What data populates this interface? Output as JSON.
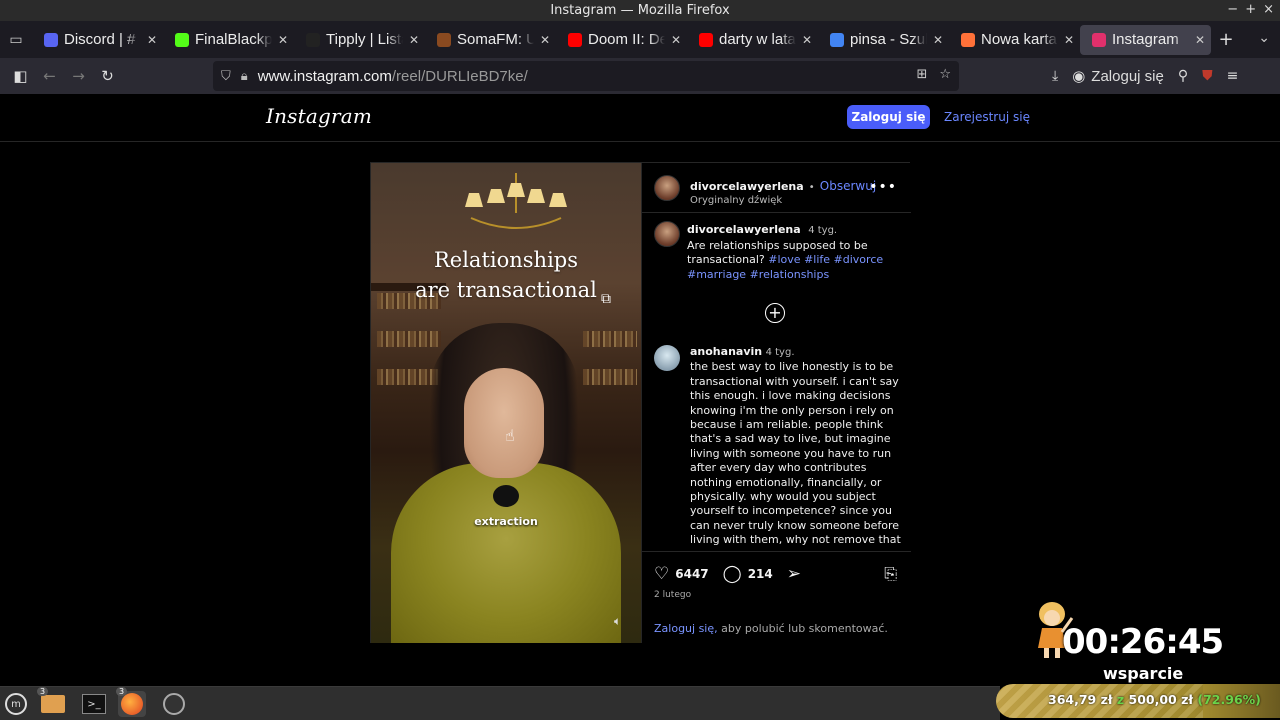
{
  "window": {
    "title": "Instagram — Mozilla Firefox",
    "controls": [
      "−",
      "+",
      "×"
    ]
  },
  "tabs": [
    {
      "label": "Discord | #",
      "icon": "discord-icon",
      "color": "#5865f2",
      "active": false
    },
    {
      "label": "FinalBlackpill",
      "icon": "kick-icon",
      "color": "#53fc18",
      "active": false
    },
    {
      "label": "Tipply | Lista",
      "icon": "tipply-icon",
      "color": "#222222",
      "active": false
    },
    {
      "label": "SomaFM: Uni",
      "icon": "somafm-icon",
      "color": "#8a4a20",
      "active": false
    },
    {
      "label": "Doom II: Deli",
      "icon": "youtube-icon",
      "color": "#ff0000",
      "active": false
    },
    {
      "label": "darty w latach",
      "icon": "youtube-icon",
      "color": "#ff0000",
      "active": false
    },
    {
      "label": "pinsa - Szuka",
      "icon": "google-icon",
      "color": "#4285f4",
      "active": false
    },
    {
      "label": "Nowa karta",
      "icon": "firefox-icon",
      "color": "#ff7139",
      "active": false
    },
    {
      "label": "Instagram",
      "icon": "instagram-icon",
      "color": "#e1306c",
      "active": true
    }
  ],
  "navbar": {
    "url_host": "www.instagram.com",
    "url_path": "/reel/DURLIeBD7ke/",
    "account_label": "Zaloguj się"
  },
  "ig": {
    "logo": "Instagram",
    "login_button": "Zaloguj się",
    "signup_link": "Zarejestruj się",
    "post": {
      "overlay_line1": "Relationships",
      "overlay_line2": "are transactional",
      "caption_word": "extraction",
      "author": "divorcelawyerlena",
      "follow_sep": "•",
      "follow": "Obserwuj",
      "audio": "Oryginalny dźwięk",
      "desc_author": "divorcelawyerlena",
      "desc_time": "4 tyg.",
      "desc_text": "Are relationships supposed to be transactional?",
      "desc_tags": [
        "#love",
        "#life",
        "#divorce",
        "#marriage",
        "#relationships"
      ],
      "comment_author": "anohanavin",
      "comment_time": "4 tyg.",
      "comment_text": "the best way to live honestly is to be transactional with yourself. i can't say this enough. i love making decisions knowing i'm the only person i rely on because i am reliable. people think that's a sad way to live, but imagine living with someone you have to run after every day who contributes nothing emotionally, financially, or physically. why would you subject yourself to incompetence? since you can never truly know someone before living with them, why not remove that risk entirely and be happy on your own? you should only live with",
      "likes": "6447",
      "comments": "214",
      "date": "2 lutego",
      "login_prompt_link": "Zaloguj się,",
      "login_prompt_rest": " aby polubić lub skomentować."
    }
  },
  "overlay": {
    "timer": "00:26:45",
    "support_label": "wsparcie",
    "goal_current": "364,79 zł",
    "goal_sep": "z",
    "goal_target": "500,00 zł",
    "goal_percent": "(72.96%)",
    "goal_fraction": 0.7296
  },
  "taskbar": {
    "items": [
      {
        "icon": "menu-icon"
      },
      {
        "icon": "files-icon",
        "badge": "3"
      },
      {
        "icon": "terminal-icon"
      },
      {
        "icon": "firefox-icon",
        "badge": "3"
      },
      {
        "icon": "obs-icon"
      }
    ]
  }
}
